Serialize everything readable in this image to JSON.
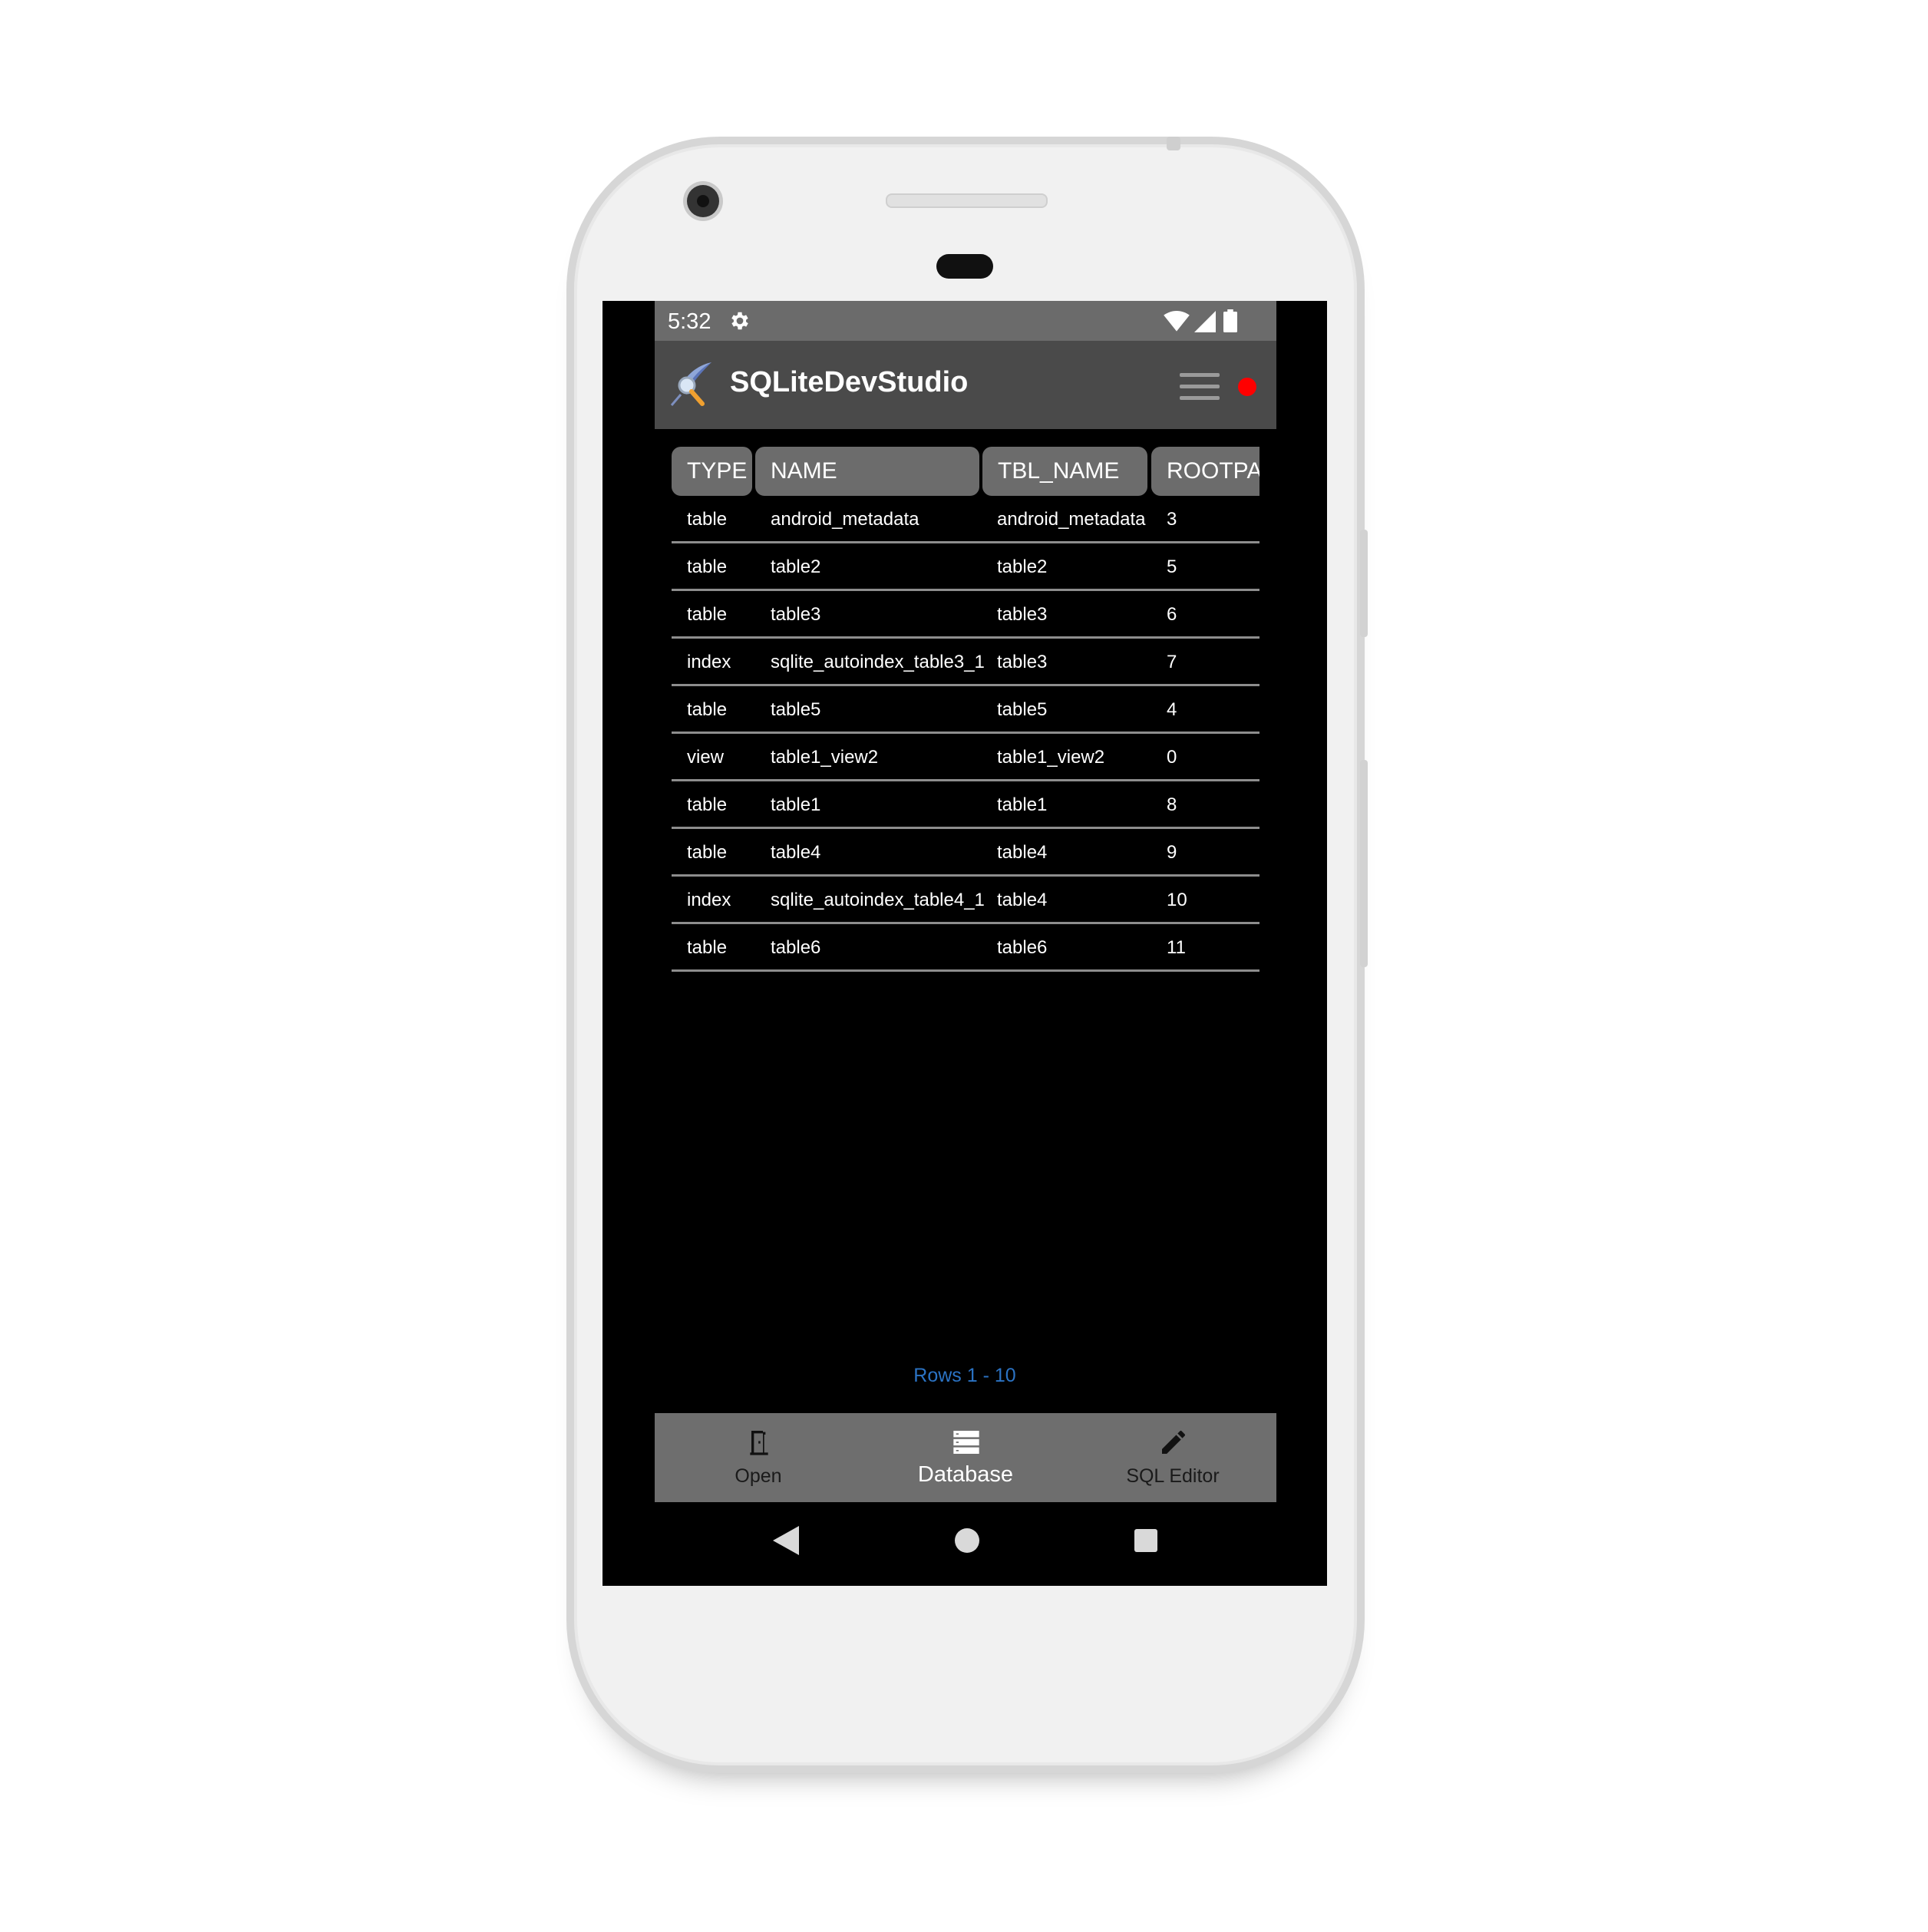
{
  "status_bar": {
    "time": "5:32",
    "icons": [
      "gear-icon",
      "wifi-icon",
      "cell-signal-icon",
      "battery-icon"
    ]
  },
  "app_bar": {
    "title": "SQLiteDevStudio",
    "logo_icon": "sqlite-feather-magnifier-logo",
    "menu_icon": "hamburger-menu-icon",
    "status_dot_color": "#ff0000"
  },
  "table": {
    "columns": [
      "TYPE",
      "NAME",
      "TBL_NAME",
      "ROOTPAG"
    ],
    "rows": [
      [
        "table",
        "android_metadata",
        "android_metadata",
        "3"
      ],
      [
        "table",
        "table2",
        "table2",
        "5"
      ],
      [
        "table",
        "table3",
        "table3",
        "6"
      ],
      [
        "index",
        "sqlite_autoindex_table3_1",
        "table3",
        "7"
      ],
      [
        "table",
        "table5",
        "table5",
        "4"
      ],
      [
        "view",
        "table1_view2",
        "table1_view2",
        "0"
      ],
      [
        "table",
        "table1",
        "table1",
        "8"
      ],
      [
        "table",
        "table4",
        "table4",
        "9"
      ],
      [
        "index",
        "sqlite_autoindex_table4_1",
        "table4",
        "10"
      ],
      [
        "table",
        "table6",
        "table6",
        "11"
      ]
    ]
  },
  "rows_info": "Rows 1 - 10",
  "bottom_nav": {
    "items": [
      {
        "label": "Open",
        "icon": "door-open-icon",
        "active": false
      },
      {
        "label": "Database",
        "icon": "database-list-icon",
        "active": true
      },
      {
        "label": "SQL Editor",
        "icon": "pencil-icon",
        "active": false
      }
    ]
  },
  "system_nav": {
    "icons": [
      "back-triangle-icon",
      "home-circle-icon",
      "recents-square-icon"
    ]
  },
  "colors": {
    "screen_bg": "#000000",
    "app_bar_bg": "#4a4a4a",
    "header_cell_bg": "#6c6c6c",
    "bottom_nav_bg": "#6e6e6e",
    "rows_info_text": "#2b73c4",
    "phone_body": "#f1f1f1"
  }
}
